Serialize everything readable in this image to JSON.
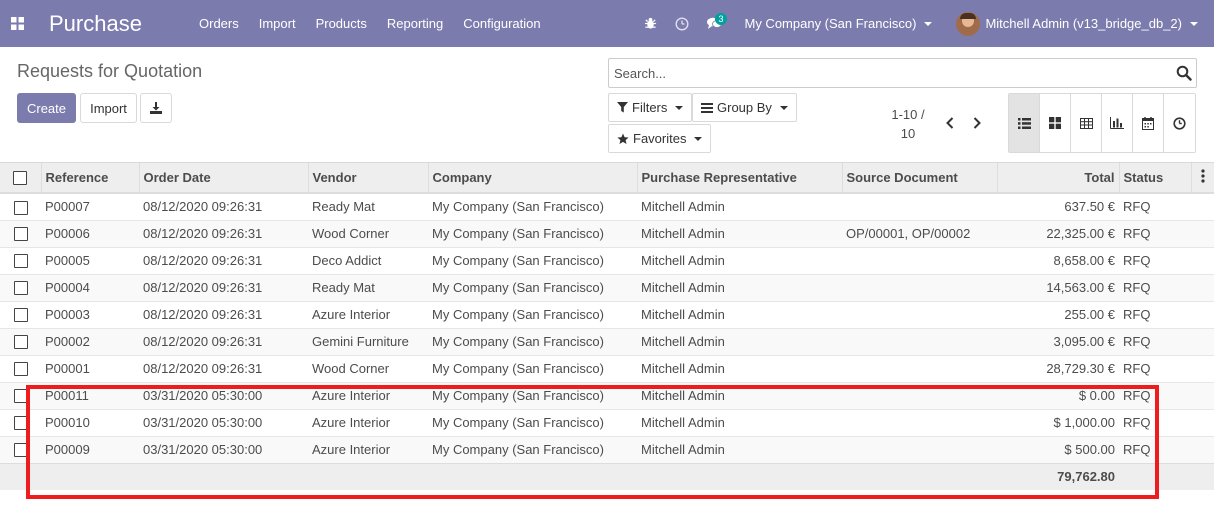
{
  "app": {
    "name": "Purchase"
  },
  "menu": [
    "Orders",
    "Import",
    "Products",
    "Reporting",
    "Configuration"
  ],
  "navbar": {
    "messages_badge": "3",
    "company": "My Company (San Francisco)",
    "user": "Mitchell Admin (v13_bridge_db_2)",
    "bg_color": "#7c7bad"
  },
  "page": {
    "title": "Requests for Quotation"
  },
  "buttons": {
    "create": "Create",
    "import": "Import"
  },
  "search": {
    "placeholder": "Search..."
  },
  "filters": {
    "filters": "Filters",
    "group_by": "Group By",
    "favorites": "Favorites"
  },
  "pager": {
    "range": "1-10 /",
    "total": "10"
  },
  "views": [
    "list-icon",
    "kanban-icon",
    "pivot-icon",
    "graph-icon",
    "calendar-icon",
    "activity-icon"
  ],
  "table": {
    "columns": [
      "Reference",
      "Order Date",
      "Vendor",
      "Company",
      "Purchase Representative",
      "Source Document",
      "Total",
      "Status"
    ],
    "rows": [
      {
        "reference": "P00007",
        "order_date": "08/12/2020 09:26:31",
        "vendor": "Ready Mat",
        "company": "My Company (San Francisco)",
        "rep": "Mitchell Admin",
        "source": "",
        "total": "637.50 €",
        "status": "RFQ"
      },
      {
        "reference": "P00006",
        "order_date": "08/12/2020 09:26:31",
        "vendor": "Wood Corner",
        "company": "My Company (San Francisco)",
        "rep": "Mitchell Admin",
        "source": "OP/00001, OP/00002",
        "total": "22,325.00 €",
        "status": "RFQ"
      },
      {
        "reference": "P00005",
        "order_date": "08/12/2020 09:26:31",
        "vendor": "Deco Addict",
        "company": "My Company (San Francisco)",
        "rep": "Mitchell Admin",
        "source": "",
        "total": "8,658.00 €",
        "status": "RFQ"
      },
      {
        "reference": "P00004",
        "order_date": "08/12/2020 09:26:31",
        "vendor": "Ready Mat",
        "company": "My Company (San Francisco)",
        "rep": "Mitchell Admin",
        "source": "",
        "total": "14,563.00 €",
        "status": "RFQ"
      },
      {
        "reference": "P00003",
        "order_date": "08/12/2020 09:26:31",
        "vendor": "Azure Interior",
        "company": "My Company (San Francisco)",
        "rep": "Mitchell Admin",
        "source": "",
        "total": "255.00 €",
        "status": "RFQ"
      },
      {
        "reference": "P00002",
        "order_date": "08/12/2020 09:26:31",
        "vendor": "Gemini Furniture",
        "company": "My Company (San Francisco)",
        "rep": "Mitchell Admin",
        "source": "",
        "total": "3,095.00 €",
        "status": "RFQ"
      },
      {
        "reference": "P00001",
        "order_date": "08/12/2020 09:26:31",
        "vendor": "Wood Corner",
        "company": "My Company (San Francisco)",
        "rep": "Mitchell Admin",
        "source": "",
        "total": "28,729.30 €",
        "status": "RFQ"
      },
      {
        "reference": "P00011",
        "order_date": "03/31/2020 05:30:00",
        "vendor": "Azure Interior",
        "company": "My Company (San Francisco)",
        "rep": "Mitchell Admin",
        "source": "",
        "total": "$ 0.00",
        "status": "RFQ"
      },
      {
        "reference": "P00010",
        "order_date": "03/31/2020 05:30:00",
        "vendor": "Azure Interior",
        "company": "My Company (San Francisco)",
        "rep": "Mitchell Admin",
        "source": "",
        "total": "$ 1,000.00",
        "status": "RFQ"
      },
      {
        "reference": "P00009",
        "order_date": "03/31/2020 05:30:00",
        "vendor": "Azure Interior",
        "company": "My Company (San Francisco)",
        "rep": "Mitchell Admin",
        "source": "",
        "total": "$ 500.00",
        "status": "RFQ"
      }
    ],
    "footer_total": "79,762.80"
  },
  "annotation": {
    "highlight_color": "#ee1c1c"
  }
}
